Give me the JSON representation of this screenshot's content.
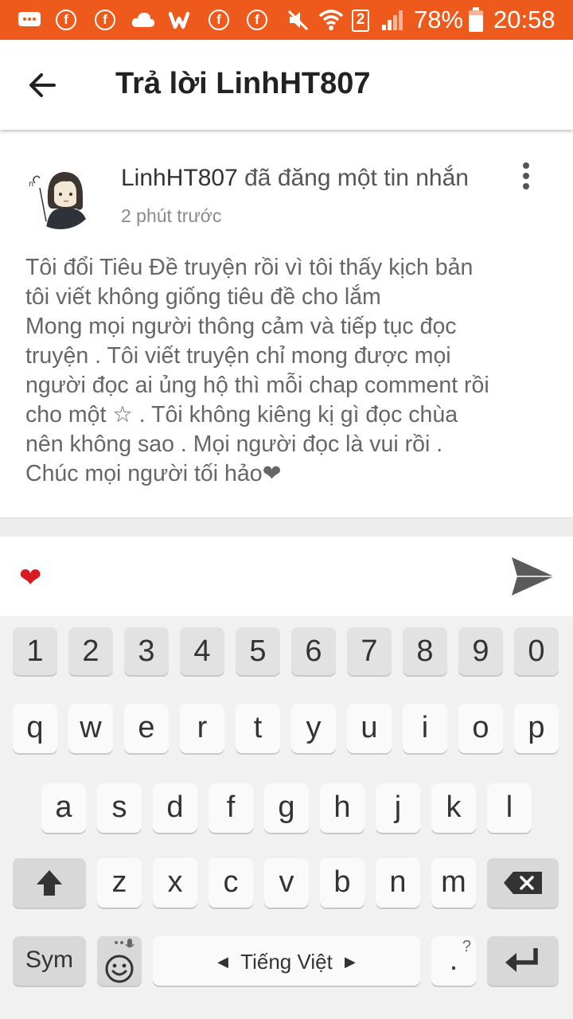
{
  "status_bar": {
    "battery_percent": "78%",
    "time": "20:58",
    "sim_badge": "2",
    "icons": [
      "message-icon",
      "facebook-icon",
      "facebook-icon",
      "cloud-icon",
      "wattpad-icon",
      "facebook-icon",
      "facebook-icon",
      "mute-icon",
      "wifi-icon",
      "sim-icon",
      "signal-icon",
      "battery-icon"
    ]
  },
  "app_bar": {
    "title": "Trả lời LinhHT807"
  },
  "post": {
    "author": "LinhHT807",
    "action": "đã đăng một tin nhắn",
    "time": "2 phút trước",
    "body_lines": [
      "Tôi đổi Tiêu Đề truyện rồi vì tôi thấy kịch bản",
      "tôi viết không giống tiêu đề cho lắm",
      "Mong mọi người thông cảm và tiếp tục đọc",
      "truyện . Tôi viết truyện chỉ mong được mọi",
      "người đọc ai ủng hộ thì mỗi chap comment  rồi",
      "cho một ☆ . Tôi không kiêng kị gì đọc chùa",
      "nên không sao . Mọi người đọc là vui rồi .",
      "Chúc mọi người tối hảo❤"
    ]
  },
  "reply": {
    "value": "❤"
  },
  "keyboard": {
    "row_numbers": [
      "1",
      "2",
      "3",
      "4",
      "5",
      "6",
      "7",
      "8",
      "9",
      "0"
    ],
    "row1": [
      "q",
      "w",
      "e",
      "r",
      "t",
      "y",
      "u",
      "i",
      "o",
      "p"
    ],
    "row2": [
      "a",
      "s",
      "d",
      "f",
      "g",
      "h",
      "j",
      "k",
      "l"
    ],
    "row3": [
      "z",
      "x",
      "c",
      "v",
      "b",
      "n",
      "m"
    ],
    "sym_label": "Sym",
    "space_label": "Tiếng Việt",
    "period_label": ".",
    "period_hint": "?"
  },
  "colors": {
    "status_bar": "#ee5a1c",
    "heart": "#d81b23"
  }
}
